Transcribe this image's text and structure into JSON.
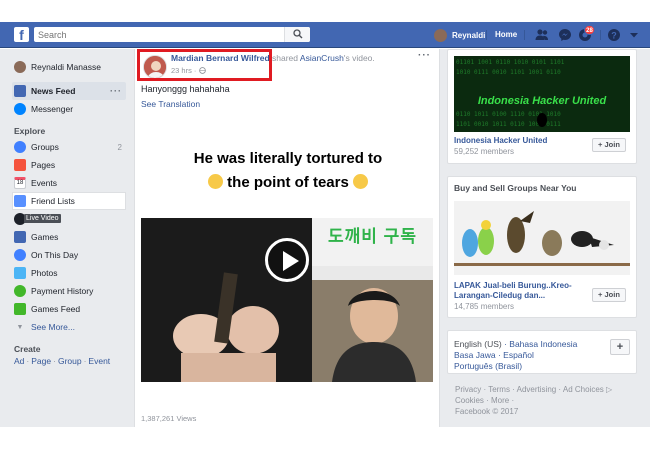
{
  "topbar": {
    "search_placeholder": "Search",
    "user_name": "Reynaldi",
    "home_label": "Home",
    "notification_count": "28"
  },
  "sidebar": {
    "profile_name": "Reynaldi Manasse",
    "items": [
      {
        "label": "News Feed"
      },
      {
        "label": "Messenger"
      }
    ],
    "explore_title": "Explore",
    "explore": [
      {
        "label": "Groups",
        "count": "2"
      },
      {
        "label": "Pages"
      },
      {
        "label": "Events"
      },
      {
        "label": "Friend Lists"
      },
      {
        "label": "Live Video"
      },
      {
        "label": "Games"
      },
      {
        "label": "On This Day"
      },
      {
        "label": "Photos"
      },
      {
        "label": "Payment History"
      },
      {
        "label": "Games Feed"
      }
    ],
    "see_more": "See More...",
    "create_title": "Create",
    "create_links": [
      "Ad",
      "Page",
      "Group",
      "Event"
    ]
  },
  "post": {
    "author": "Mardian Bernard Wilfred",
    "action_text": "shared",
    "page_name": "AsianCrush",
    "suffix": "'s video.",
    "time": "23 hrs · ",
    "text": "Hanyonggg hahahaha",
    "see_translation": "See Translation",
    "headline_line1": "He was literally tortured to",
    "headline_line2": "the point of tears",
    "korean_text": "도깨비 구독",
    "views": "1,387,261 Views"
  },
  "right": {
    "group1": {
      "name": "Indonesia Hacker United",
      "members": "59,252 members",
      "banner_text": "Indonesia Hacker United",
      "join": "+ Join"
    },
    "buy_sell_title": "Buy and Sell Groups Near You",
    "group2": {
      "name": "LAPAK Jual-beli Burung..Kreo-Larangan-Ciledug dan...",
      "members": "14,785 members",
      "join": "+ Join"
    },
    "languages": {
      "current": "English (US)",
      "others": [
        "Bahasa Indonesia",
        "Basa Jawa",
        "Español",
        "Português (Brasil)"
      ],
      "plus": "+"
    },
    "footer": {
      "line1": "Privacy · Terms · Advertising · Ad Choices ▷",
      "line2": "Cookies · More ·",
      "line3": "Facebook © 2017"
    }
  }
}
